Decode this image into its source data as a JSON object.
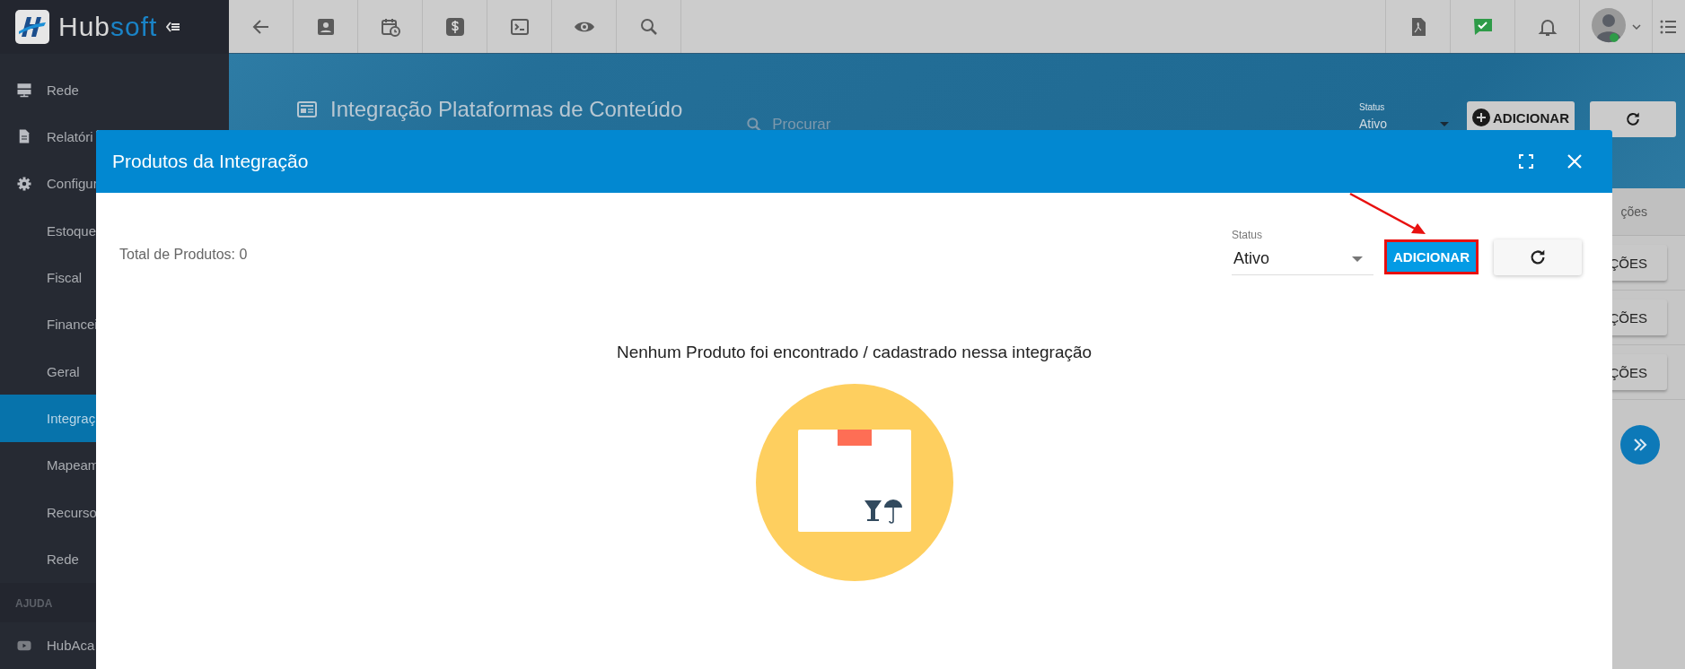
{
  "topbar": {
    "brand_name": "Hub",
    "brand_suffix": "soft"
  },
  "sidebar": {
    "items": [
      {
        "label": "Rede",
        "selected": false
      },
      {
        "label": "Relatóri",
        "selected": false
      },
      {
        "label": "Configur",
        "selected": false,
        "children": [
          {
            "label": "Estoque",
            "selected": false
          },
          {
            "label": "Fiscal",
            "selected": false
          },
          {
            "label": "Financei",
            "selected": false
          },
          {
            "label": "Geral",
            "selected": false
          },
          {
            "label": "Integraç",
            "selected": true
          },
          {
            "label": "Mapeam",
            "selected": false
          },
          {
            "label": "Recurso",
            "selected": false
          },
          {
            "label": "Rede",
            "selected": false
          }
        ]
      }
    ],
    "help_heading": "AJUDA",
    "help_items": [
      {
        "label": "HubAca",
        "selected": false
      }
    ]
  },
  "page": {
    "title": "Integração Plataformas de Conteúdo",
    "search_placeholder": "Procurar",
    "status_label": "Status",
    "status_value": "Ativo",
    "add_button": "ADICIONAR",
    "tab_label": "ções",
    "row_buttons": [
      "ÇÕES",
      "ÇÕES",
      "ÇÕES"
    ]
  },
  "modal": {
    "title": "Produtos da Integração",
    "total": "Total de Produtos: 0",
    "status_label": "Status",
    "status_value": "Ativo",
    "add_button": {
      "label": "ADICIONAR",
      "highlighted": true
    },
    "empty_message": "Nenhum Produto foi encontrado / cadastrado nessa integração"
  }
}
